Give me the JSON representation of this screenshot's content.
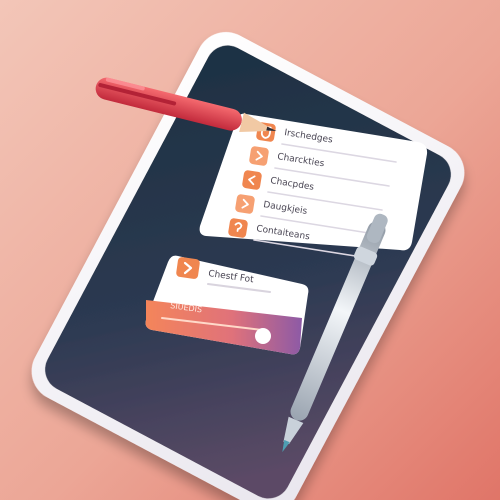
{
  "illustration": {
    "checklist_items": [
      {
        "label": "Irschedges",
        "icon": "shield-check-icon"
      },
      {
        "label": "Charckties",
        "icon": "chevron-right-icon"
      },
      {
        "label": "Chacpdes",
        "icon": "chevron-left-icon"
      },
      {
        "label": "Daugkjeis",
        "icon": "chevron-right-icon"
      },
      {
        "label": "Contaiteans",
        "icon": "question-icon"
      }
    ],
    "notification_card": {
      "title": "Chestf Fot",
      "subtitle": "SIUEDIS",
      "icon": "chevron-right-icon"
    },
    "colors": {
      "background_light": "#f2c3b6",
      "background_dark": "#e27a6e",
      "screen_dark": "#233446",
      "screen_mid": "#3d4258",
      "accent_orange": "#f0864f",
      "accent_purple": "#8c63a8",
      "pen_red": "#e8414c",
      "stylus_silver": "#cfd6de"
    }
  }
}
